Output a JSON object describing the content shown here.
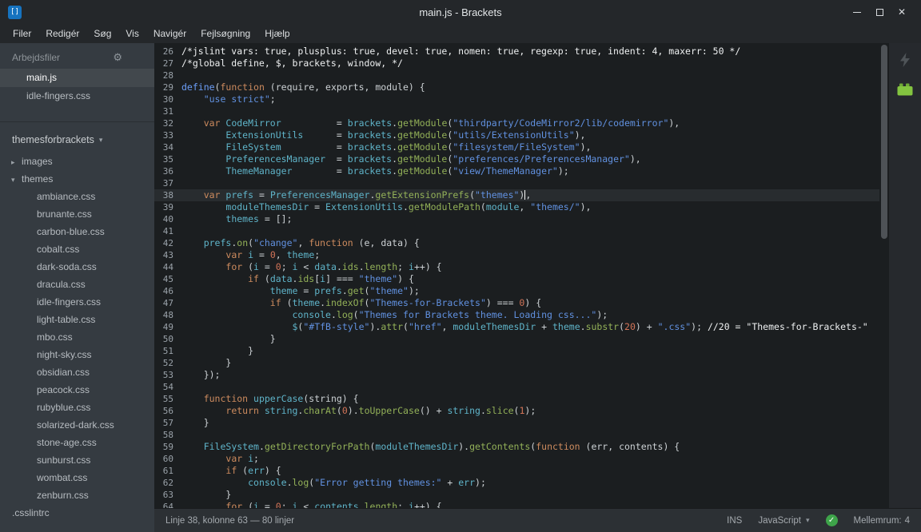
{
  "titlebar": {
    "title": "main.js - Brackets"
  },
  "menu": {
    "items": [
      "Filer",
      "Redigér",
      "Søg",
      "Vis",
      "Navigér",
      "Fejlsøgning",
      "Hjælp"
    ]
  },
  "icons": {
    "logo": "[]",
    "gear": "⚙",
    "project_caret": "▾",
    "folder_collapsed": "▸",
    "folder_expanded": "▾",
    "close": "✕",
    "lang_caret": "▾",
    "lint_check": "✓"
  },
  "sidebar": {
    "working_files_header": "Arbejdsfiler",
    "working_files": [
      {
        "name": "main.js",
        "active": true
      },
      {
        "name": "idle-fingers.css",
        "active": false
      }
    ],
    "project": {
      "name": "themesforbrackets"
    },
    "tree": [
      {
        "label": "images",
        "type": "folder",
        "expanded": false,
        "depth": 0
      },
      {
        "label": "themes",
        "type": "folder",
        "expanded": true,
        "depth": 0
      },
      {
        "label": "ambiance.css",
        "type": "file",
        "depth": 1
      },
      {
        "label": "brunante.css",
        "type": "file",
        "depth": 1
      },
      {
        "label": "carbon-blue.css",
        "type": "file",
        "depth": 1
      },
      {
        "label": "cobalt.css",
        "type": "file",
        "depth": 1
      },
      {
        "label": "dark-soda.css",
        "type": "file",
        "depth": 1
      },
      {
        "label": "dracula.css",
        "type": "file",
        "depth": 1
      },
      {
        "label": "idle-fingers.css",
        "type": "file",
        "depth": 1
      },
      {
        "label": "light-table.css",
        "type": "file",
        "depth": 1
      },
      {
        "label": "mbo.css",
        "type": "file",
        "depth": 1
      },
      {
        "label": "night-sky.css",
        "type": "file",
        "depth": 1
      },
      {
        "label": "obsidian.css",
        "type": "file",
        "depth": 1
      },
      {
        "label": "peacock.css",
        "type": "file",
        "depth": 1
      },
      {
        "label": "rubyblue.css",
        "type": "file",
        "depth": 1
      },
      {
        "label": "solarized-dark.css",
        "type": "file",
        "depth": 1
      },
      {
        "label": "stone-age.css",
        "type": "file",
        "depth": 1
      },
      {
        "label": "sunburst.css",
        "type": "file",
        "depth": 1
      },
      {
        "label": "wombat.css",
        "type": "file",
        "depth": 1
      },
      {
        "label": "zenburn.css",
        "type": "file",
        "depth": 1
      },
      {
        "label": ".csslintrc",
        "type": "file",
        "depth": 0
      }
    ]
  },
  "editor": {
    "first_line": 26,
    "active_line": 38,
    "cursor": {
      "line": 38,
      "column": 63
    },
    "lines": [
      [
        [
          "c",
          "/*jslint vars: true, plusplus: true, devel: true, nomen: true, regexp: true, indent: 4, maxerr: 50 */"
        ]
      ],
      [
        [
          "c",
          "/*global define, $, brackets, window, */"
        ]
      ],
      [],
      [
        [
          "d",
          "define"
        ],
        [
          "p",
          "("
        ],
        [
          "k",
          "function"
        ],
        [
          "p",
          " (require, exports, module) {"
        ]
      ],
      [
        [
          "p",
          "    "
        ],
        [
          "s",
          "\"use strict\""
        ],
        [
          "p",
          ";"
        ]
      ],
      [],
      [
        [
          "p",
          "    "
        ],
        [
          "k",
          "var"
        ],
        [
          "p",
          " "
        ],
        [
          "v",
          "CodeMirror"
        ],
        [
          "p",
          "          = "
        ],
        [
          "v",
          "brackets"
        ],
        [
          "p",
          "."
        ],
        [
          "f",
          "getModule"
        ],
        [
          "p",
          "("
        ],
        [
          "s",
          "\"thirdparty/CodeMirror2/lib/codemirror\""
        ],
        [
          "p",
          "),"
        ]
      ],
      [
        [
          "p",
          "        "
        ],
        [
          "v",
          "ExtensionUtils"
        ],
        [
          "p",
          "      = "
        ],
        [
          "v",
          "brackets"
        ],
        [
          "p",
          "."
        ],
        [
          "f",
          "getModule"
        ],
        [
          "p",
          "("
        ],
        [
          "s",
          "\"utils/ExtensionUtils\""
        ],
        [
          "p",
          "),"
        ]
      ],
      [
        [
          "p",
          "        "
        ],
        [
          "v",
          "FileSystem"
        ],
        [
          "p",
          "          = "
        ],
        [
          "v",
          "brackets"
        ],
        [
          "p",
          "."
        ],
        [
          "f",
          "getModule"
        ],
        [
          "p",
          "("
        ],
        [
          "s",
          "\"filesystem/FileSystem\""
        ],
        [
          "p",
          "),"
        ]
      ],
      [
        [
          "p",
          "        "
        ],
        [
          "v",
          "PreferencesManager"
        ],
        [
          "p",
          "  = "
        ],
        [
          "v",
          "brackets"
        ],
        [
          "p",
          "."
        ],
        [
          "f",
          "getModule"
        ],
        [
          "p",
          "("
        ],
        [
          "s",
          "\"preferences/PreferencesManager\""
        ],
        [
          "p",
          "),"
        ]
      ],
      [
        [
          "p",
          "        "
        ],
        [
          "v",
          "ThemeManager"
        ],
        [
          "p",
          "        = "
        ],
        [
          "v",
          "brackets"
        ],
        [
          "p",
          "."
        ],
        [
          "f",
          "getModule"
        ],
        [
          "p",
          "("
        ],
        [
          "s",
          "\"view/ThemeManager\""
        ],
        [
          "p",
          ");"
        ]
      ],
      [],
      [
        [
          "p",
          "    "
        ],
        [
          "k",
          "var"
        ],
        [
          "p",
          " "
        ],
        [
          "v",
          "prefs"
        ],
        [
          "p",
          " = "
        ],
        [
          "v",
          "PreferencesManager"
        ],
        [
          "p",
          "."
        ],
        [
          "f",
          "getExtensionPrefs"
        ],
        [
          "p",
          "("
        ],
        [
          "s",
          "\"themes\""
        ],
        [
          "p",
          ")"
        ],
        [
          "cursor",
          ""
        ],
        [
          "p",
          ","
        ]
      ],
      [
        [
          "p",
          "        "
        ],
        [
          "v",
          "moduleThemesDir"
        ],
        [
          "p",
          " = "
        ],
        [
          "v",
          "ExtensionUtils"
        ],
        [
          "p",
          "."
        ],
        [
          "f",
          "getModulePath"
        ],
        [
          "p",
          "("
        ],
        [
          "v",
          "module"
        ],
        [
          "p",
          ", "
        ],
        [
          "s",
          "\"themes/\""
        ],
        [
          "p",
          "),"
        ]
      ],
      [
        [
          "p",
          "        "
        ],
        [
          "v",
          "themes"
        ],
        [
          "p",
          " = [];"
        ]
      ],
      [],
      [
        [
          "p",
          "    "
        ],
        [
          "v",
          "prefs"
        ],
        [
          "p",
          "."
        ],
        [
          "f",
          "on"
        ],
        [
          "p",
          "("
        ],
        [
          "s",
          "\"change\""
        ],
        [
          "p",
          ", "
        ],
        [
          "k",
          "function"
        ],
        [
          "p",
          " (e, data) {"
        ]
      ],
      [
        [
          "p",
          "        "
        ],
        [
          "k",
          "var"
        ],
        [
          "p",
          " "
        ],
        [
          "v",
          "i"
        ],
        [
          "p",
          " = "
        ],
        [
          "n",
          "0"
        ],
        [
          "p",
          ", "
        ],
        [
          "v",
          "theme"
        ],
        [
          "p",
          ";"
        ]
      ],
      [
        [
          "p",
          "        "
        ],
        [
          "k",
          "for"
        ],
        [
          "p",
          " ("
        ],
        [
          "v",
          "i"
        ],
        [
          "p",
          " = "
        ],
        [
          "n",
          "0"
        ],
        [
          "p",
          "; "
        ],
        [
          "v",
          "i"
        ],
        [
          "p",
          " < "
        ],
        [
          "v",
          "data"
        ],
        [
          "p",
          "."
        ],
        [
          "f",
          "ids"
        ],
        [
          "p",
          "."
        ],
        [
          "f",
          "length"
        ],
        [
          "p",
          "; "
        ],
        [
          "v",
          "i"
        ],
        [
          "p",
          "++) {"
        ]
      ],
      [
        [
          "p",
          "            "
        ],
        [
          "k",
          "if"
        ],
        [
          "p",
          " ("
        ],
        [
          "v",
          "data"
        ],
        [
          "p",
          "."
        ],
        [
          "f",
          "ids"
        ],
        [
          "p",
          "["
        ],
        [
          "v",
          "i"
        ],
        [
          "p",
          "] === "
        ],
        [
          "s",
          "\"theme\""
        ],
        [
          "p",
          ") {"
        ]
      ],
      [
        [
          "p",
          "                "
        ],
        [
          "v",
          "theme"
        ],
        [
          "p",
          " = "
        ],
        [
          "v",
          "prefs"
        ],
        [
          "p",
          "."
        ],
        [
          "f",
          "get"
        ],
        [
          "p",
          "("
        ],
        [
          "s",
          "\"theme\""
        ],
        [
          "p",
          ");"
        ]
      ],
      [
        [
          "p",
          "                "
        ],
        [
          "k",
          "if"
        ],
        [
          "p",
          " ("
        ],
        [
          "v",
          "theme"
        ],
        [
          "p",
          "."
        ],
        [
          "f",
          "indexOf"
        ],
        [
          "p",
          "("
        ],
        [
          "s",
          "\"Themes-for-Brackets\""
        ],
        [
          "p",
          ") === "
        ],
        [
          "n",
          "0"
        ],
        [
          "p",
          ") {"
        ]
      ],
      [
        [
          "p",
          "                    "
        ],
        [
          "v",
          "console"
        ],
        [
          "p",
          "."
        ],
        [
          "f",
          "log"
        ],
        [
          "p",
          "("
        ],
        [
          "s",
          "\"Themes for Brackets theme. Loading css...\""
        ],
        [
          "p",
          ");"
        ]
      ],
      [
        [
          "p",
          "                    "
        ],
        [
          "v",
          "$"
        ],
        [
          "p",
          "("
        ],
        [
          "s",
          "\"#TfB-style\""
        ],
        [
          "p",
          ")."
        ],
        [
          "f",
          "attr"
        ],
        [
          "p",
          "("
        ],
        [
          "s",
          "\"href\""
        ],
        [
          "p",
          ", "
        ],
        [
          "v",
          "moduleThemesDir"
        ],
        [
          "p",
          " + "
        ],
        [
          "v",
          "theme"
        ],
        [
          "p",
          "."
        ],
        [
          "f",
          "substr"
        ],
        [
          "p",
          "("
        ],
        [
          "n",
          "20"
        ],
        [
          "p",
          ") + "
        ],
        [
          "s",
          "\".css\""
        ],
        [
          "p",
          "); "
        ],
        [
          "c",
          "//20 = \"Themes-for-Brackets-\""
        ]
      ],
      [
        [
          "p",
          "                }"
        ]
      ],
      [
        [
          "p",
          "            }"
        ]
      ],
      [
        [
          "p",
          "        }"
        ]
      ],
      [
        [
          "p",
          "    });"
        ]
      ],
      [],
      [
        [
          "p",
          "    "
        ],
        [
          "k",
          "function"
        ],
        [
          "p",
          " "
        ],
        [
          "v",
          "upperCase"
        ],
        [
          "p",
          "(string) {"
        ]
      ],
      [
        [
          "p",
          "        "
        ],
        [
          "k",
          "return"
        ],
        [
          "p",
          " "
        ],
        [
          "v",
          "string"
        ],
        [
          "p",
          "."
        ],
        [
          "f",
          "charAt"
        ],
        [
          "p",
          "("
        ],
        [
          "n",
          "0"
        ],
        [
          "p",
          ")."
        ],
        [
          "f",
          "toUpperCase"
        ],
        [
          "p",
          "() + "
        ],
        [
          "v",
          "string"
        ],
        [
          "p",
          "."
        ],
        [
          "f",
          "slice"
        ],
        [
          "p",
          "("
        ],
        [
          "n",
          "1"
        ],
        [
          "p",
          ");"
        ]
      ],
      [
        [
          "p",
          "    }"
        ]
      ],
      [],
      [
        [
          "p",
          "    "
        ],
        [
          "v",
          "FileSystem"
        ],
        [
          "p",
          "."
        ],
        [
          "f",
          "getDirectoryForPath"
        ],
        [
          "p",
          "("
        ],
        [
          "v",
          "moduleThemesDir"
        ],
        [
          "p",
          ")."
        ],
        [
          "f",
          "getContents"
        ],
        [
          "p",
          "("
        ],
        [
          "k",
          "function"
        ],
        [
          "p",
          " (err, contents) {"
        ]
      ],
      [
        [
          "p",
          "        "
        ],
        [
          "k",
          "var"
        ],
        [
          "p",
          " "
        ],
        [
          "v",
          "i"
        ],
        [
          "p",
          ";"
        ]
      ],
      [
        [
          "p",
          "        "
        ],
        [
          "k",
          "if"
        ],
        [
          "p",
          " ("
        ],
        [
          "v",
          "err"
        ],
        [
          "p",
          ") {"
        ]
      ],
      [
        [
          "p",
          "            "
        ],
        [
          "v",
          "console"
        ],
        [
          "p",
          "."
        ],
        [
          "f",
          "log"
        ],
        [
          "p",
          "("
        ],
        [
          "s",
          "\"Error getting themes:\""
        ],
        [
          "p",
          " + "
        ],
        [
          "v",
          "err"
        ],
        [
          "p",
          ");"
        ]
      ],
      [
        [
          "p",
          "        }"
        ]
      ],
      [
        [
          "p",
          "        "
        ],
        [
          "k",
          "for"
        ],
        [
          "p",
          " ("
        ],
        [
          "v",
          "i"
        ],
        [
          "p",
          " = "
        ],
        [
          "n",
          "0"
        ],
        [
          "p",
          "; "
        ],
        [
          "v",
          "i"
        ],
        [
          "p",
          " < "
        ],
        [
          "v",
          "contents"
        ],
        [
          "p",
          "."
        ],
        [
          "f",
          "length"
        ],
        [
          "p",
          "; "
        ],
        [
          "v",
          "i"
        ],
        [
          "p",
          "++) {"
        ]
      ]
    ]
  },
  "statusbar": {
    "position_info": "Linje 38, kolonne 63 — 80 linjer",
    "insert_mode": "INS",
    "language": "JavaScript",
    "spacing_label": "Mellemrum:",
    "spacing_value": "4"
  },
  "colors": {
    "titlebar_bg": "#24272a",
    "sidebar_bg": "#353b41",
    "sidebar_active_bg": "#42484d",
    "editor_bg": "#1b1e20",
    "active_line_bg": "#282c2f",
    "statusbar_bg": "#2c3034",
    "toolbar_bg": "#26292d",
    "accent_blue": "#1673bf",
    "lint_ok_green": "#3ea44a",
    "extension_green": "#83c440",
    "syntax_keyword": "#cd8b5e",
    "syntax_variable": "#5fb4c9",
    "syntax_function": "#93b158",
    "syntax_string": "#6191e0",
    "syntax_define": "#6c9ef8",
    "syntax_number": "#d27458",
    "syntax_comment": "#eef0f1",
    "syntax_plain": "#ccd1d4",
    "line_number": "#9aa2a9"
  }
}
